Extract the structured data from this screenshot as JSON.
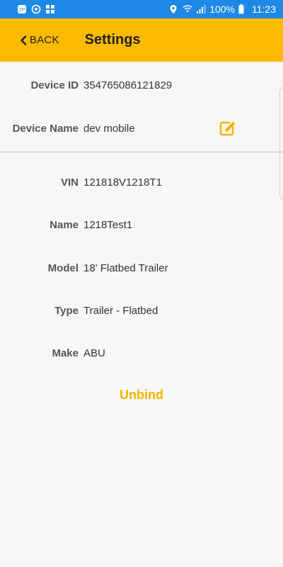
{
  "status_bar": {
    "battery": "100%",
    "time": "11:23"
  },
  "header": {
    "back_label": "BACK",
    "title": "Settings"
  },
  "device": {
    "id_label": "Device ID",
    "id_value": "354765086121829",
    "name_label": "Device Name",
    "name_value": "dev mobile"
  },
  "vehicle": {
    "vin_label": "VIN",
    "vin_value": "121818V1218T1",
    "name_label": "Name",
    "name_value": "1218Test1",
    "model_label": "Model",
    "model_value": "18' Flatbed Trailer",
    "type_label": "Type",
    "type_value": "Trailer - Flatbed",
    "make_label": "Make",
    "make_value": "ABU"
  },
  "actions": {
    "unbind_label": "Unbind"
  },
  "colors": {
    "status_bar": "#1e88e5",
    "app_bar": "#fbb900",
    "accent": "#f2b400"
  },
  "icons": {
    "edit": "edit-icon",
    "back": "chevron-left-icon"
  }
}
